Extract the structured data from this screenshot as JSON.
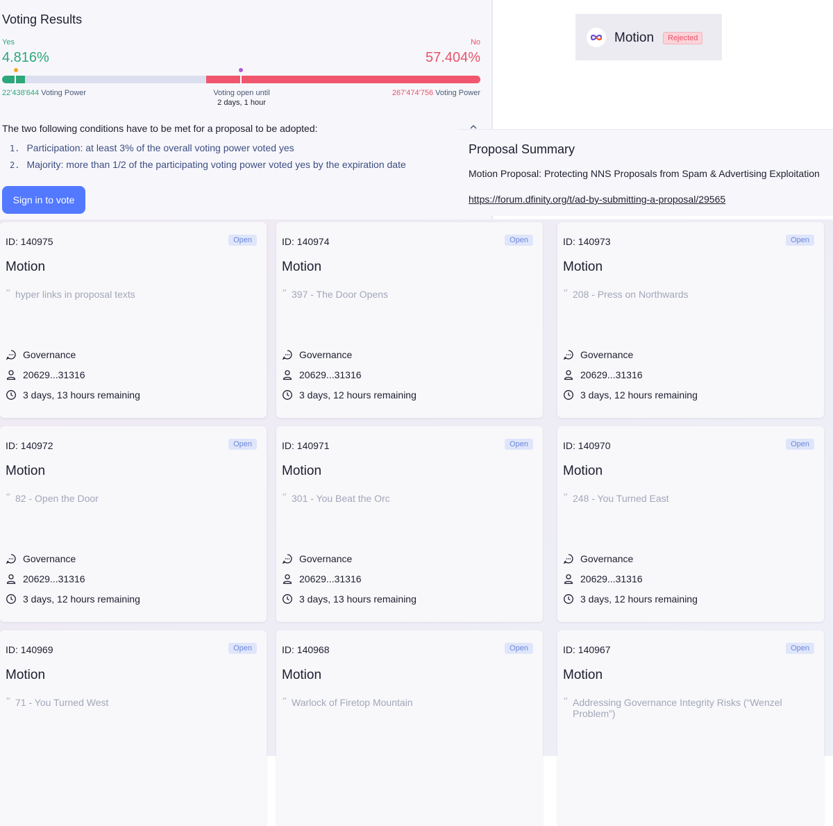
{
  "voting": {
    "title": "Voting Results",
    "yes_label": "Yes",
    "no_label": "No",
    "yes_percent": "4.816%",
    "no_percent": "57.404%",
    "yes_fraction": 0.04816,
    "no_fraction": 0.57404,
    "yes_power": "22'438'644",
    "no_power": "267'474'756",
    "power_unit": "Voting Power",
    "open_until_label": "Voting open until",
    "open_until_value": "2 days, 1 hour",
    "conditions_intro": "The two following conditions have to be met for a proposal to be adopted:",
    "conditions": [
      {
        "num": "1.",
        "text": "Participation: at least 3% of the overall voting power voted yes"
      },
      {
        "num": "2.",
        "text": "Majority: more than 1/2 of the participating voting power voted yes by the expiration date"
      }
    ],
    "sign_in_label": "Sign in to vote",
    "colors": {
      "yes": "#2ea77a",
      "no": "#f0566e",
      "accent": "#5279ff"
    }
  },
  "badge": {
    "title": "Motion",
    "status": "Rejected",
    "logo_icon": "infinity-logo-icon"
  },
  "summary": {
    "title": "Proposal Summary",
    "text": "Motion Proposal: Protecting NNS Proposals from Spam & Advertising Exploitation",
    "link": "https://forum.dfinity.org/t/ad-by-submitting-a-proposal/29565"
  },
  "cards": [
    {
      "id": "ID: 140975",
      "status": "Open",
      "type": "Motion",
      "quote": "hyper links in proposal texts",
      "topic": "Governance",
      "proposer": "20629...31316",
      "remaining": "3 days, 13 hours remaining"
    },
    {
      "id": "ID: 140974",
      "status": "Open",
      "type": "Motion",
      "quote": "397 - The Door Opens",
      "topic": "Governance",
      "proposer": "20629...31316",
      "remaining": "3 days, 12 hours remaining"
    },
    {
      "id": "ID: 140973",
      "status": "Open",
      "type": "Motion",
      "quote": "208 - Press on Northwards",
      "topic": "Governance",
      "proposer": "20629...31316",
      "remaining": "3 days, 12 hours remaining"
    },
    {
      "id": "ID: 140972",
      "status": "Open",
      "type": "Motion",
      "quote": "82 - Open the Door",
      "topic": "Governance",
      "proposer": "20629...31316",
      "remaining": "3 days, 12 hours remaining"
    },
    {
      "id": "ID: 140971",
      "status": "Open",
      "type": "Motion",
      "quote": "301 - You Beat the Orc",
      "topic": "Governance",
      "proposer": "20629...31316",
      "remaining": "3 days, 13 hours remaining"
    },
    {
      "id": "ID: 140970",
      "status": "Open",
      "type": "Motion",
      "quote": "248 - You Turned East",
      "topic": "Governance",
      "proposer": "20629...31316",
      "remaining": "3 days, 12 hours remaining"
    },
    {
      "id": "ID: 140969",
      "status": "Open",
      "type": "Motion",
      "quote": "71 - You Turned West",
      "topic": "",
      "proposer": "",
      "remaining": ""
    },
    {
      "id": "ID: 140968",
      "status": "Open",
      "type": "Motion",
      "quote": "Warlock of Firetop Mountain",
      "topic": "",
      "proposer": "",
      "remaining": ""
    },
    {
      "id": "ID: 140967",
      "status": "Open",
      "type": "Motion",
      "quote": "Addressing Governance Integrity Risks (“Wenzel Problem”)",
      "topic": "",
      "proposer": "",
      "remaining": ""
    }
  ],
  "icons": {
    "topic": "chat-bubble-icon",
    "proposer": "user-icon",
    "time": "clock-icon",
    "quote": "quote-icon",
    "collapse": "chevron-up-icon"
  }
}
